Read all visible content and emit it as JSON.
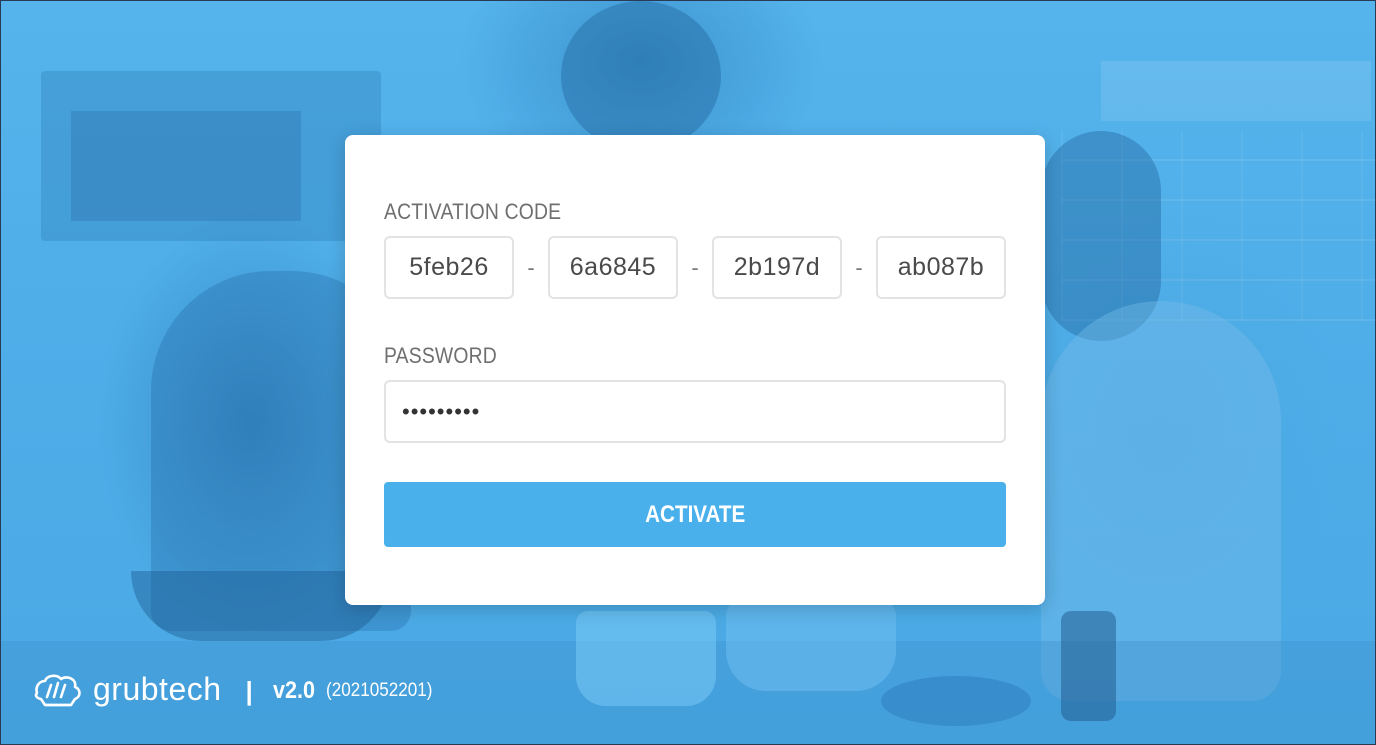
{
  "activation": {
    "label": "ACTIVATION CODE",
    "codes": [
      "5feb26",
      "6a6845",
      "2b197d",
      "ab087b"
    ],
    "separator": "-"
  },
  "password": {
    "label": "PASSWORD",
    "value": "•••••••••"
  },
  "activate_button": {
    "label": "ACTIVATE"
  },
  "footer": {
    "brand_name": "grubtech",
    "divider": "|",
    "version": "v2.0",
    "build": "(2021052201)"
  },
  "colors": {
    "accent": "#4ab0ec",
    "background": "#4fb0ea",
    "card": "#ffffff",
    "label": "#6f6f6f"
  }
}
